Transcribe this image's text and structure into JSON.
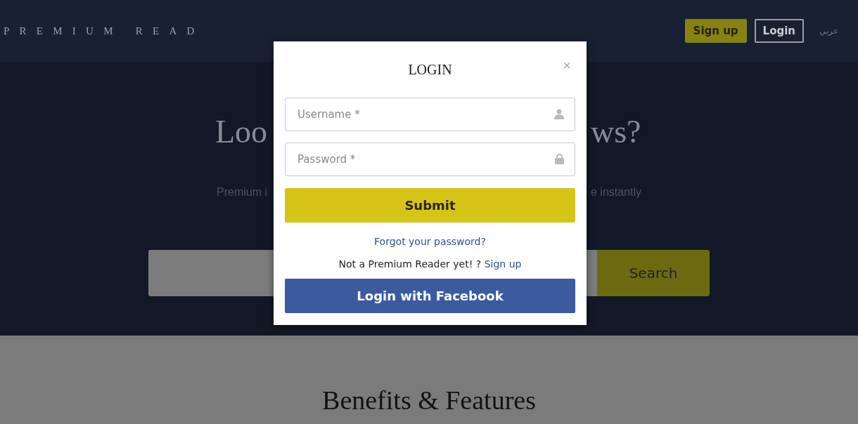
{
  "header": {
    "logo": "PREMIUM READ",
    "buttons": [
      {
        "label": "Sign up",
        "kind": "primary"
      },
      {
        "label": "Login",
        "kind": "outline"
      }
    ],
    "language": "عربي"
  },
  "hero": {
    "heading_left": "Loo",
    "heading_right": "ws?",
    "subtitle_left": "Premium i",
    "subtitle_right": "e instantly",
    "search_button": "Search"
  },
  "features": {
    "heading": "Benefits & Features"
  },
  "modal": {
    "title": "LOGIN",
    "close": "×",
    "fields": [
      {
        "placeholder": "Username *",
        "kind": "user"
      },
      {
        "placeholder": "Password *",
        "kind": "lock"
      }
    ],
    "submit": "Submit",
    "forgot": "Forgot your password?",
    "signup_prompt": "Not a Premium Reader yet! ?",
    "signup_link": "Sign up",
    "facebook": "Login with Facebook"
  }
}
